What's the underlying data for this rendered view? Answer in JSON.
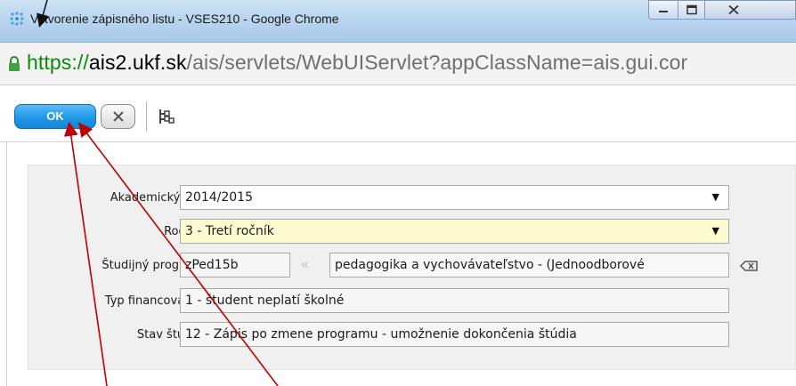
{
  "window": {
    "title": "Vytvorenie zápisného listu - VSES210 - Google Chrome",
    "icon": "app-dots-icon",
    "controls": [
      "minimize-icon",
      "maximize-icon",
      "close-icon"
    ]
  },
  "address": {
    "scheme": "https://",
    "host": "ais2.ukf.sk",
    "path": "/ais/servlets/WebUIServlet?appClassName=ais.gui.cor"
  },
  "toolbar": {
    "ok_label": "OK",
    "cancel_icon": "close-x-icon",
    "tree_icon": "tree-structure-icon"
  },
  "form": {
    "academic_year": {
      "label": "Akademický rok",
      "value": "2014/2015"
    },
    "year": {
      "label": "Ročník",
      "value": "3 - Tretí ročník"
    },
    "program": {
      "label": "Študijný program",
      "code": "zPed15b",
      "name": "pedagogika a vychovávateľstvo - (Jednoodborové"
    },
    "financing": {
      "label": "Typ financovania",
      "value": "1 - študent neplatí školné"
    },
    "status": {
      "label": "Stav štúdia",
      "value": "12 - Zápis po zmene programu - umožnenie dokončenia štúdia"
    }
  },
  "colors": {
    "ok_button": "#1f97e8",
    "highlight_field": "#fdfbd0",
    "annotation_arrow": "#c00000",
    "url_scheme": "#0a8a0a"
  }
}
